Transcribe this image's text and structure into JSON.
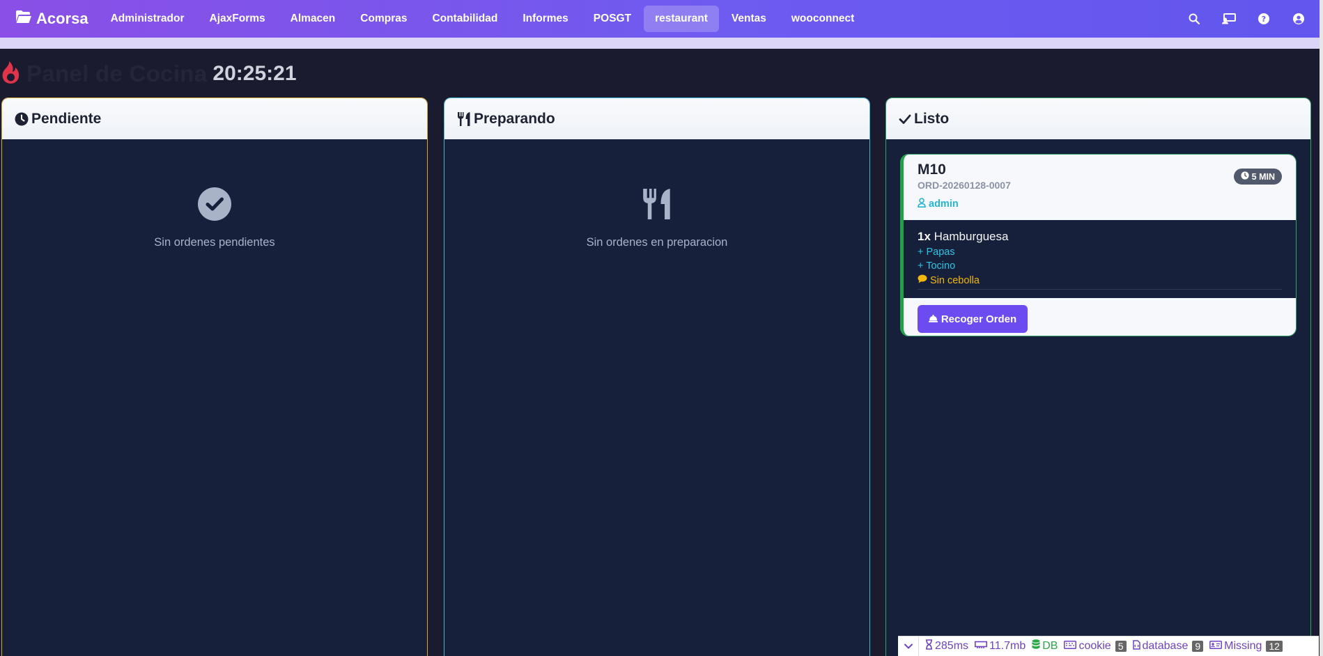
{
  "navbar": {
    "brand": "Acorsa",
    "items": [
      {
        "label": "Administrador"
      },
      {
        "label": "AjaxForms"
      },
      {
        "label": "Almacen"
      },
      {
        "label": "Compras"
      },
      {
        "label": "Contabilidad"
      },
      {
        "label": "Informes"
      },
      {
        "label": "POSGT"
      },
      {
        "label": "restaurant",
        "active": true
      },
      {
        "label": "Ventas"
      },
      {
        "label": "wooconnect"
      }
    ],
    "right_icons": [
      "search-icon",
      "monitor-user-icon",
      "help-icon",
      "user-circle-icon"
    ]
  },
  "header": {
    "icon": "fire-icon",
    "title": "Panel de Cocina",
    "clock": "20:25:21"
  },
  "columns": [
    {
      "id": "pendiente",
      "icon": "clock-icon",
      "label": "Pendiente",
      "count": "0",
      "accent": "#d8a93a",
      "empty_icon": "check-circle-icon",
      "empty_text": "Sin ordenes pendientes"
    },
    {
      "id": "preparando",
      "icon": "utensils-icon",
      "label": "Preparando",
      "count": "0",
      "accent": "#3fb8d6",
      "empty_icon": "utensils-icon",
      "empty_text": "Sin ordenes en preparacion"
    },
    {
      "id": "listo",
      "icon": "check-icon",
      "label": "Listo",
      "count": "1",
      "accent": "#2ea36a"
    }
  ],
  "order": {
    "table": "M10",
    "code": "ORD-20260128-0007",
    "user": "admin",
    "time_badge": "5 MIN",
    "item_qty": "1x",
    "item_name": "Hamburguesa",
    "modifiers": [
      "+ Papas",
      "+ Tocino"
    ],
    "note": "Sin cebolla",
    "action_label": "Recoger Orden"
  },
  "debugbar": {
    "time": "285ms",
    "memory": "11.7mb",
    "db_label": "DB",
    "cookie_label": "cookie",
    "cookie_count": "5",
    "database_label": "database",
    "database_count": "9",
    "missing_label": "Missing",
    "missing_count": "12"
  },
  "colors": {
    "accent": "#6c4cf0",
    "background": "#1a1b2e",
    "column_bg": "#16203b",
    "ready_green": "#24a148",
    "modifier_cyan": "#2cc6e6",
    "note_yellow": "#f1b80d",
    "fire_red": "#e0344b"
  }
}
